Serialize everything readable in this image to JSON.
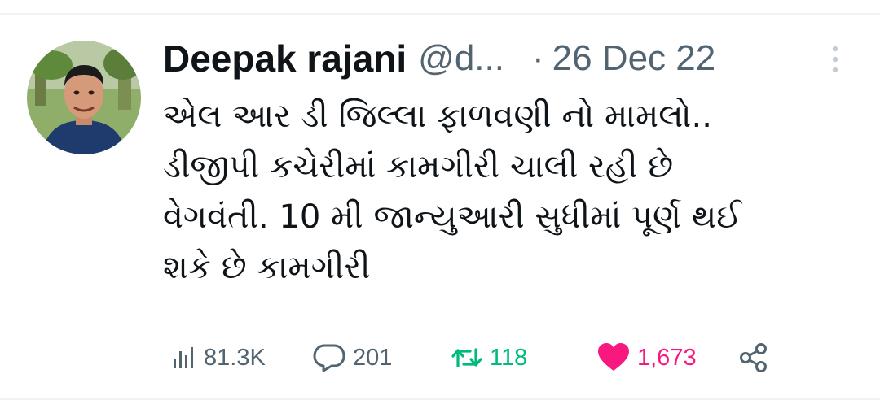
{
  "tweet": {
    "author_name": "Deepak rajani",
    "handle": "@d...",
    "separator": "·",
    "date": "26 Dec 22",
    "text_lines": [
      "એલ આર ડી જિલ્લા ફાળવણી નો મામલો..",
      "ડીજીપી કચેરીમાં કામગીરી ચાલી રહી છે",
      "વેગવંતી. 10 મી જાન્યુઆરી સુધીમાં પૂર્ણ થઈ",
      "શકે છે કામગીરી"
    ]
  },
  "actions": {
    "views": "81.3K",
    "replies": "201",
    "retweets": "118",
    "likes": "1,673"
  },
  "colors": {
    "text_primary": "#0f1419",
    "text_secondary": "#536471",
    "retweet_active": "#00ba7c",
    "like_active": "#f91880",
    "divider": "#eff3f4"
  },
  "icons": {
    "more": "more-vertical-icon",
    "views": "bar-chart-icon",
    "replies": "speech-bubble-icon",
    "retweets": "retweet-icon",
    "likes": "heart-icon",
    "share": "share-icon"
  }
}
